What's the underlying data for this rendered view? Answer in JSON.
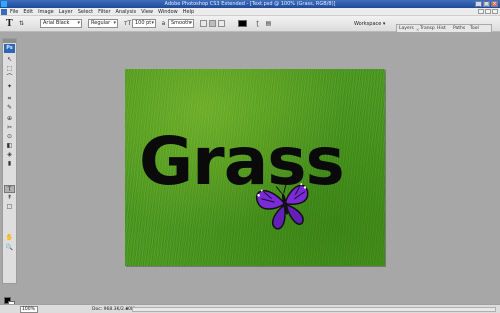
{
  "window": {
    "title": "Adobe Photoshop CS3 Extended - [Text.psd @ 100% (Grass, RGB/8)]",
    "controls": [
      "_",
      "□",
      "×"
    ]
  },
  "menu": {
    "items": [
      "File",
      "Edit",
      "Image",
      "Layer",
      "Select",
      "Filter",
      "Analysis",
      "View",
      "Window",
      "Help"
    ]
  },
  "options": {
    "tool_icon": "T",
    "font_family": "Arial Black",
    "font_style": "Regular",
    "font_size": "100 pt",
    "antialias": "Smooth",
    "text_color": "#000000",
    "workspace_label": "Workspace ▾"
  },
  "palettes": {
    "tabs": [
      "Layers",
      "Transp",
      "Hist",
      "Paths",
      "Tool"
    ],
    "separator": "×"
  },
  "toolbox": {
    "badge": "Ps",
    "tools": [
      "↖",
      "⬚",
      "⌒",
      "✦",
      "⌗",
      "✎",
      "⊕",
      "✂",
      "⊙",
      "◧",
      "◈",
      "▮",
      "T",
      "↟",
      "□",
      "✋",
      "🔍"
    ]
  },
  "canvas": {
    "text": "Grass",
    "background": "grass texture",
    "butterfly_color": "#7a2bd6"
  },
  "status": {
    "zoom": "100%",
    "doc": "Doc: 968.3K/2.40M",
    "arrow": "▸"
  }
}
